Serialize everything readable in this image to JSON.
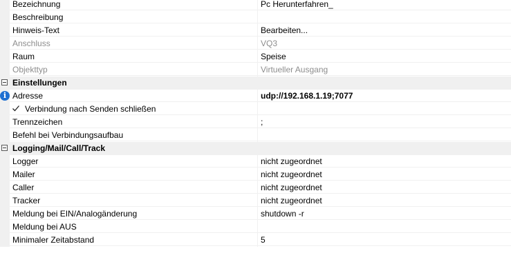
{
  "rows": [
    {
      "name": "Bezeichnung",
      "value": "Pc Herunterfahren_"
    },
    {
      "name": "Beschreibung",
      "value": ""
    },
    {
      "name": "Hinweis-Text",
      "value": "Bearbeiten..."
    },
    {
      "name": "Anschluss",
      "value": "VQ3"
    },
    {
      "name": "Raum",
      "value": "Speise"
    },
    {
      "name": "Objekttyp",
      "value": "Virtueller Ausgang"
    }
  ],
  "categories": {
    "einstellungen": "Einstellungen",
    "logging": "Logging/Mail/Call/Track"
  },
  "einstellungen": {
    "adresse_name": "Adresse",
    "adresse_value": "udp://192.168.1.19;7077",
    "verbindung_checkbox": "Verbindung nach Senden schließen",
    "verbindung_checked": true,
    "trennzeichen_name": "Trennzeichen",
    "trennzeichen_value": ";",
    "befehl_name": "Befehl bei Verbindungsaufbau",
    "befehl_value": ""
  },
  "logging": [
    {
      "name": "Logger",
      "value": "nicht zugeordnet"
    },
    {
      "name": "Mailer",
      "value": "nicht zugeordnet"
    },
    {
      "name": "Caller",
      "value": "nicht zugeordnet"
    },
    {
      "name": "Tracker",
      "value": "nicht zugeordnet"
    },
    {
      "name": "Meldung bei EIN/Analogänderung",
      "value": "shutdown -r"
    },
    {
      "name": "Meldung bei AUS",
      "value": ""
    },
    {
      "name": "Minimaler Zeitabstand",
      "value": "5"
    }
  ],
  "icons": {
    "info": "info-icon",
    "collapse": "collapse-icon",
    "check": "checkmark-icon"
  },
  "colors": {
    "gutter": "#f0f0f0",
    "disabled_text": "#8d8d8d",
    "info_blue": "#1f6fd1"
  }
}
